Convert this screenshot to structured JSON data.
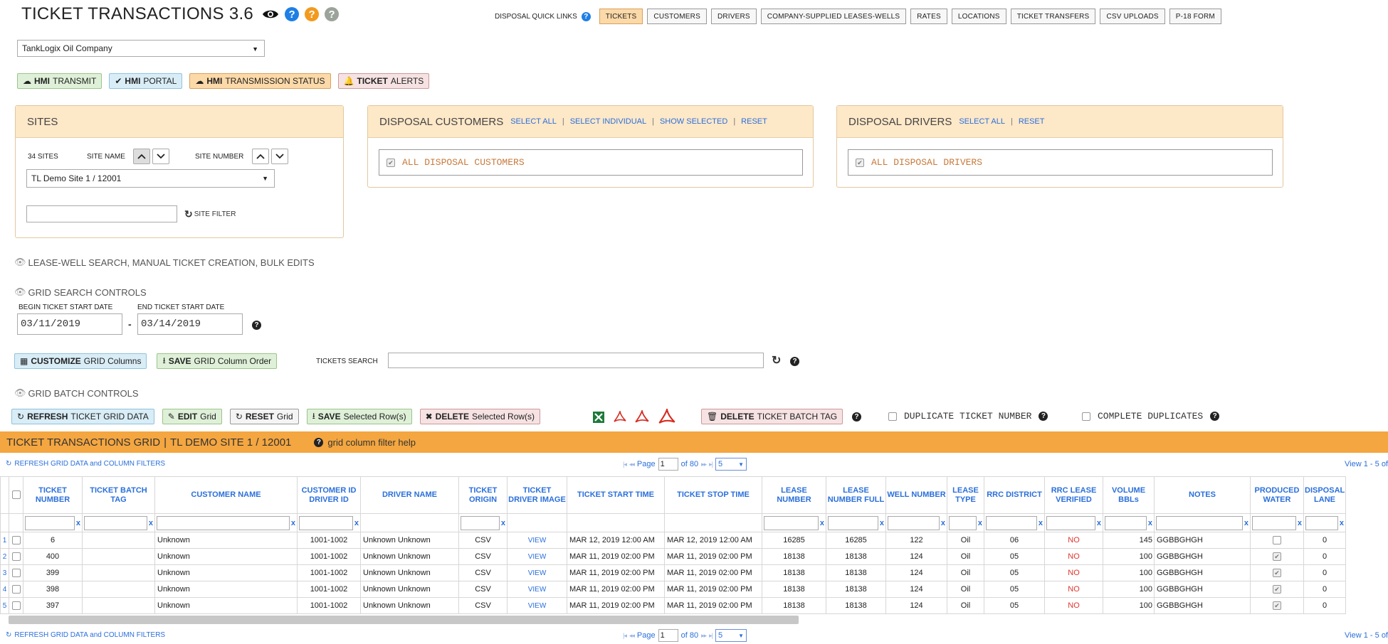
{
  "header": {
    "title": "TICKET TRANSACTIONS 3.6",
    "icons": [
      "eye-icon",
      "help-blue-icon",
      "help-orange-icon",
      "help-gray-icon"
    ]
  },
  "quick_links": {
    "label": "DISPOSAL QUICK LINKS",
    "items": [
      "TICKETS",
      "CUSTOMERS",
      "DRIVERS",
      "COMPANY-SUPPLIED LEASES-WELLS",
      "RATES",
      "LOCATIONS",
      "TICKET TRANSFERS",
      "CSV UPLOADS",
      "P-18 FORM"
    ],
    "active": "TICKETS"
  },
  "company_select": {
    "value": "TankLogix Oil Company"
  },
  "hmi_buttons": {
    "transmit": {
      "bold": "HMI",
      "rest": "TRANSMIT"
    },
    "portal": {
      "bold": "HMI",
      "rest": "PORTAL"
    },
    "status": {
      "bold": "HMI",
      "rest": "TRANSMISSION STATUS"
    },
    "alerts": {
      "bold": "TICKET",
      "rest": "ALERTS"
    }
  },
  "sites": {
    "title": "SITES",
    "count": "34 SITES",
    "sort_name": "SITE NAME",
    "sort_number": "SITE NUMBER",
    "selected": "TL Demo Site 1  /  12001",
    "filter_label": "SITE FILTER",
    "filter_value": ""
  },
  "disposal_customers": {
    "title": "DISPOSAL CUSTOMERS",
    "links": [
      "SELECT ALL",
      "SELECT INDIVIDUAL",
      "SHOW SELECTED",
      "RESET"
    ],
    "item": "ALL DISPOSAL CUSTOMERS"
  },
  "disposal_drivers": {
    "title": "DISPOSAL DRIVERS",
    "links": [
      "SELECT ALL",
      "RESET"
    ],
    "item": "ALL DISPOSAL DRIVERS"
  },
  "sections": {
    "lease_well": "LEASE-WELL SEARCH, MANUAL TICKET CREATION, BULK EDITS",
    "grid_search": "GRID SEARCH CONTROLS",
    "grid_batch": "GRID BATCH CONTROLS"
  },
  "date_range": {
    "begin_label": "BEGIN TICKET START DATE",
    "begin_value": "03/11/2019",
    "end_label": "END TICKET START DATE",
    "end_value": "03/14/2019",
    "separator": "-"
  },
  "grid_columns_buttons": {
    "customize": {
      "bold": "CUSTOMIZE",
      "rest": "GRID Columns"
    },
    "save": {
      "bold": "SAVE",
      "rest": "GRID Column Order"
    }
  },
  "tickets_search": {
    "label": "TICKETS SEARCH",
    "value": ""
  },
  "batch_buttons": {
    "refresh": {
      "bold": "REFRESH",
      "rest": "TICKET GRID DATA"
    },
    "edit": {
      "bold": "EDIT",
      "rest": "Grid"
    },
    "reset": {
      "bold": "RESET",
      "rest": "Grid"
    },
    "save": {
      "bold": "SAVE",
      "rest": "Selected Row(s)"
    },
    "delete": {
      "bold": "DELETE",
      "rest": "Selected Row(s)"
    },
    "delete_tag": {
      "bold": "DELETE",
      "rest": "TICKET BATCH TAG"
    },
    "duplicate": "DUPLICATE TICKET NUMBER",
    "complete": "COMPLETE DUPLICATES"
  },
  "grid": {
    "title": "TICKET TRANSACTIONS GRID",
    "subtitle": "TL DEMO SITE 1  /  12001",
    "help": "grid column filter help",
    "refresh_link": "REFRESH GRID DATA and COLUMN FILTERS",
    "page_label": "Page",
    "page_value": "1",
    "of_label": "of 80",
    "rows_per_page": "5",
    "view_info": "View 1 - 5 of",
    "columns": [
      "TICKET NUMBER",
      "TICKET BATCH TAG",
      "CUSTOMER NAME",
      "CUSTOMER ID DRIVER ID",
      "DRIVER NAME",
      "TICKET ORIGIN",
      "TICKET DRIVER IMAGE",
      "TICKET START TIME",
      "TICKET STOP TIME",
      "LEASE NUMBER",
      "LEASE NUMBER FULL",
      "WELL NUMBER",
      "LEASE TYPE",
      "RRC DISTRICT",
      "RRC LEASE VERIFIED",
      "VOLUME BBLs",
      "NOTES",
      "PRODUCED WATER",
      "DISPOSAL LANE"
    ],
    "rows": [
      {
        "n": "1",
        "ticket": "6",
        "batch": "",
        "customer": "Unknown",
        "ids": "1001-1002",
        "driver": "Unknown Unknown",
        "origin": "CSV",
        "image": "VIEW",
        "start": "MAR 12, 2019 12:00 AM",
        "stop": "MAR 12, 2019 12:00 AM",
        "lease": "16285",
        "lease_full": "16285",
        "well": "122",
        "type": "Oil",
        "district": "06",
        "verified": "NO",
        "volume": "145",
        "notes": "GGBBGHGH",
        "produced": false,
        "lane": "0"
      },
      {
        "n": "2",
        "ticket": "400",
        "batch": "",
        "customer": "Unknown",
        "ids": "1001-1002",
        "driver": "Unknown Unknown",
        "origin": "CSV",
        "image": "VIEW",
        "start": "MAR 11, 2019 02:00 PM",
        "stop": "MAR 11, 2019 02:00 PM",
        "lease": "18138",
        "lease_full": "18138",
        "well": "124",
        "type": "Oil",
        "district": "05",
        "verified": "NO",
        "volume": "100",
        "notes": "GGBBGHGH",
        "produced": true,
        "lane": "0"
      },
      {
        "n": "3",
        "ticket": "399",
        "batch": "",
        "customer": "Unknown",
        "ids": "1001-1002",
        "driver": "Unknown Unknown",
        "origin": "CSV",
        "image": "VIEW",
        "start": "MAR 11, 2019 02:00 PM",
        "stop": "MAR 11, 2019 02:00 PM",
        "lease": "18138",
        "lease_full": "18138",
        "well": "124",
        "type": "Oil",
        "district": "05",
        "verified": "NO",
        "volume": "100",
        "notes": "GGBBGHGH",
        "produced": true,
        "lane": "0"
      },
      {
        "n": "4",
        "ticket": "398",
        "batch": "",
        "customer": "Unknown",
        "ids": "1001-1002",
        "driver": "Unknown Unknown",
        "origin": "CSV",
        "image": "VIEW",
        "start": "MAR 11, 2019 02:00 PM",
        "stop": "MAR 11, 2019 02:00 PM",
        "lease": "18138",
        "lease_full": "18138",
        "well": "124",
        "type": "Oil",
        "district": "05",
        "verified": "NO",
        "volume": "100",
        "notes": "GGBBGHGH",
        "produced": true,
        "lane": "0"
      },
      {
        "n": "5",
        "ticket": "397",
        "batch": "",
        "customer": "Unknown",
        "ids": "1001-1002",
        "driver": "Unknown Unknown",
        "origin": "CSV",
        "image": "VIEW",
        "start": "MAR 11, 2019 02:00 PM",
        "stop": "MAR 11, 2019 02:00 PM",
        "lease": "18138",
        "lease_full": "18138",
        "well": "124",
        "type": "Oil",
        "district": "05",
        "verified": "NO",
        "volume": "100",
        "notes": "GGBBGHGH",
        "produced": true,
        "lane": "0"
      }
    ]
  },
  "colors": {
    "accent_blue": "#2a6fdb",
    "grid_bar_orange": "#f4a640",
    "panel_head": "#fde8c8",
    "no_red": "#e0342c"
  }
}
